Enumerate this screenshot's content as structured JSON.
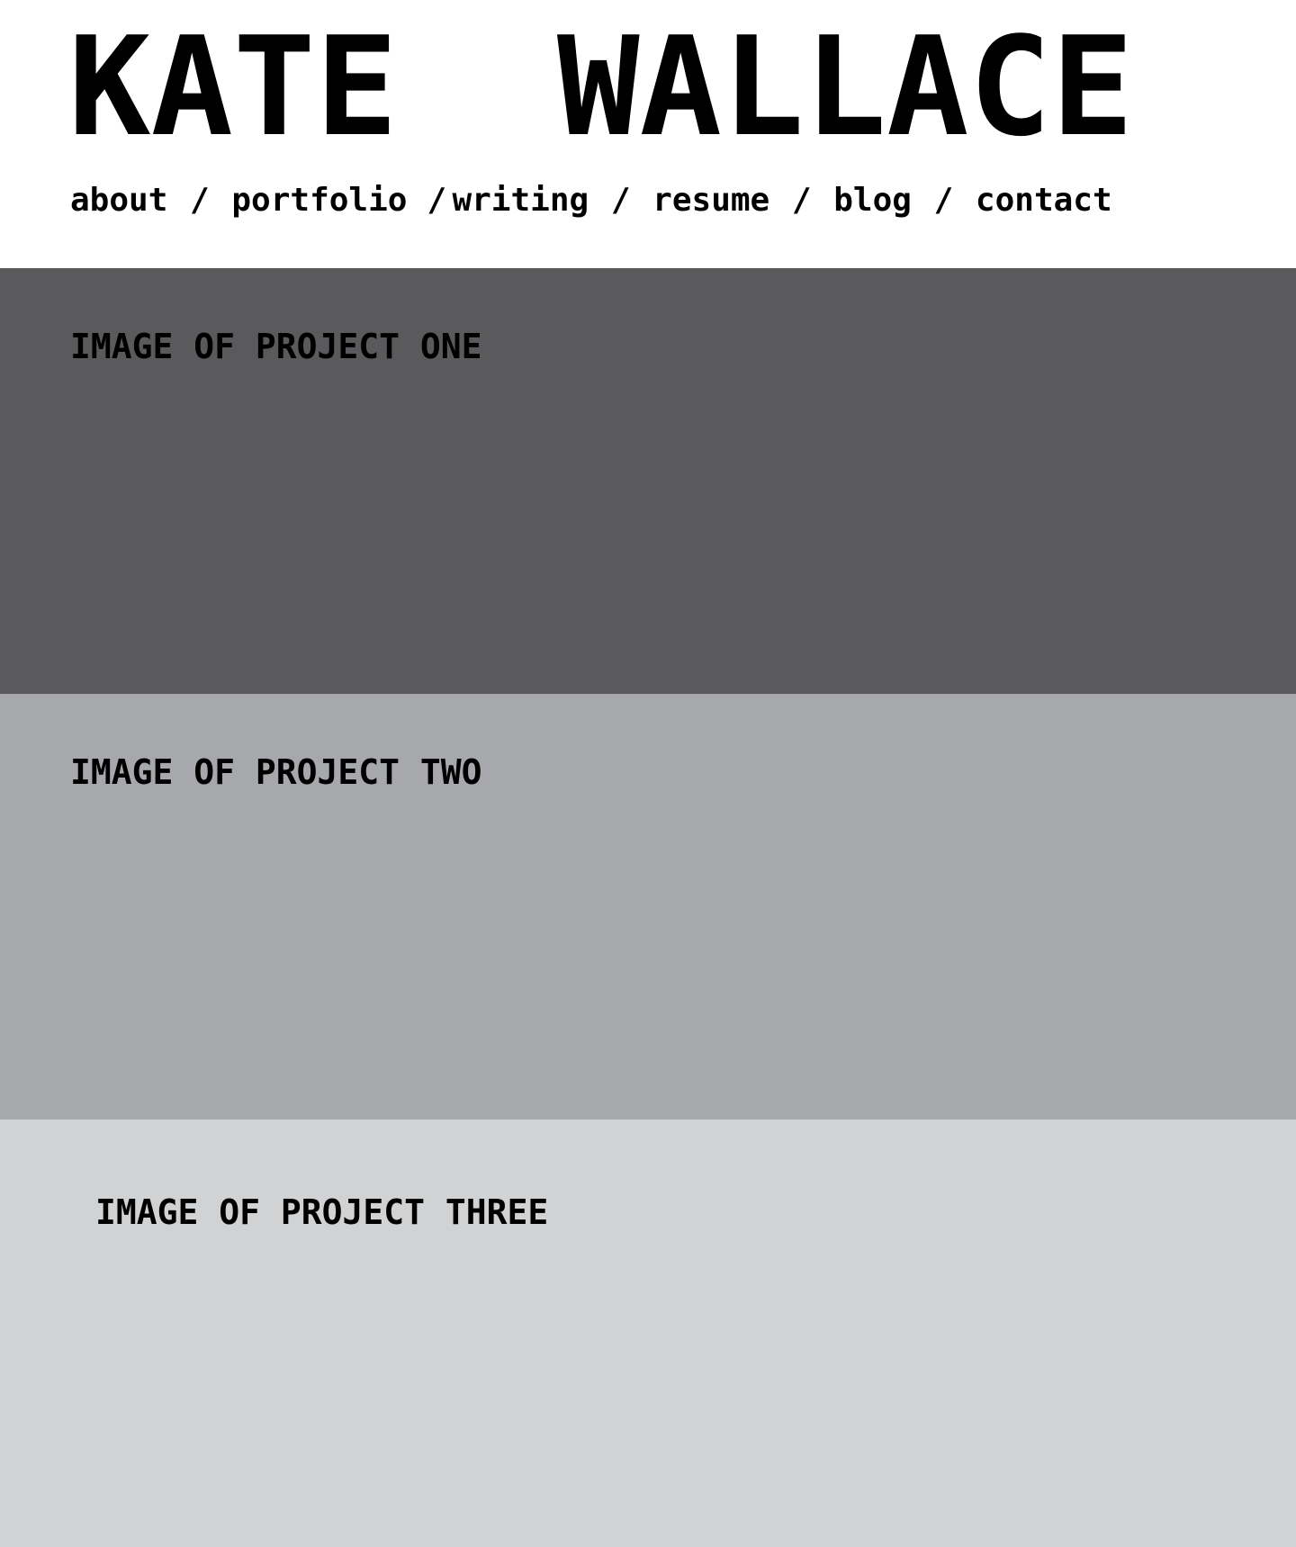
{
  "site": {
    "title_first": "KATE",
    "title_last": "WALLACE"
  },
  "nav": {
    "items": [
      {
        "label": "about"
      },
      {
        "label": "portfolio"
      },
      {
        "label": "writing"
      },
      {
        "label": "resume"
      },
      {
        "label": "blog"
      },
      {
        "label": "contact"
      }
    ],
    "separator": "/"
  },
  "projects": [
    {
      "caption": "IMAGE OF PROJECT ONE",
      "color": "#5a5a5c"
    },
    {
      "caption": "IMAGE OF PROJECT TWO",
      "color": "#a7a8ab"
    },
    {
      "caption": "IMAGE OF PROJECT THREE",
      "color": "#d1d2d4"
    }
  ]
}
